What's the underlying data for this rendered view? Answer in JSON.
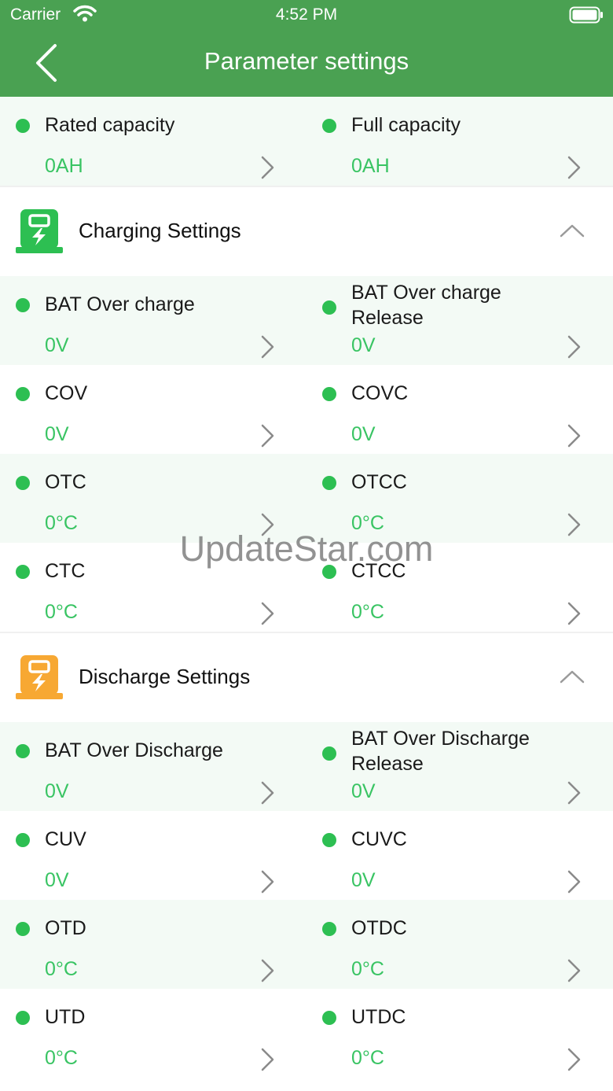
{
  "status_bar": {
    "carrier": "Carrier",
    "time": "4:52 PM"
  },
  "header": {
    "title": "Parameter settings"
  },
  "capacity": [
    {
      "label": "Rated capacity",
      "value": "0AH"
    },
    {
      "label": "Full capacity",
      "value": "0AH"
    }
  ],
  "charging": {
    "title": "Charging Settings",
    "icon_color": "#2dbf52",
    "rows": [
      {
        "left": {
          "label": "BAT Over charge",
          "value": "0V"
        },
        "right": {
          "label": "BAT Over charge Release",
          "value": "0V"
        }
      },
      {
        "left": {
          "label": "COV",
          "value": "0V"
        },
        "right": {
          "label": "COVC",
          "value": "0V"
        }
      },
      {
        "left": {
          "label": "OTC",
          "value": "0°C"
        },
        "right": {
          "label": "OTCC",
          "value": "0°C"
        }
      },
      {
        "left": {
          "label": "CTC",
          "value": "0°C"
        },
        "right": {
          "label": "CTCC",
          "value": "0°C"
        }
      }
    ]
  },
  "discharge": {
    "title": "Discharge Settings",
    "icon_color": "#f7a833",
    "rows": [
      {
        "left": {
          "label": "BAT Over Discharge",
          "value": "0V"
        },
        "right": {
          "label": "BAT Over Discharge Release",
          "value": "0V"
        }
      },
      {
        "left": {
          "label": "CUV",
          "value": "0V"
        },
        "right": {
          "label": "CUVC",
          "value": "0V"
        }
      },
      {
        "left": {
          "label": "OTD",
          "value": "0°C"
        },
        "right": {
          "label": "OTDC",
          "value": "0°C"
        }
      },
      {
        "left": {
          "label": "UTD",
          "value": "0°C"
        },
        "right": {
          "label": "UTDC",
          "value": "0°C"
        }
      }
    ]
  },
  "colors": {
    "header": "#4aa152",
    "accent": "#39c463",
    "row_tint": "#f3faf5"
  },
  "watermark": "UpdateStar.com"
}
